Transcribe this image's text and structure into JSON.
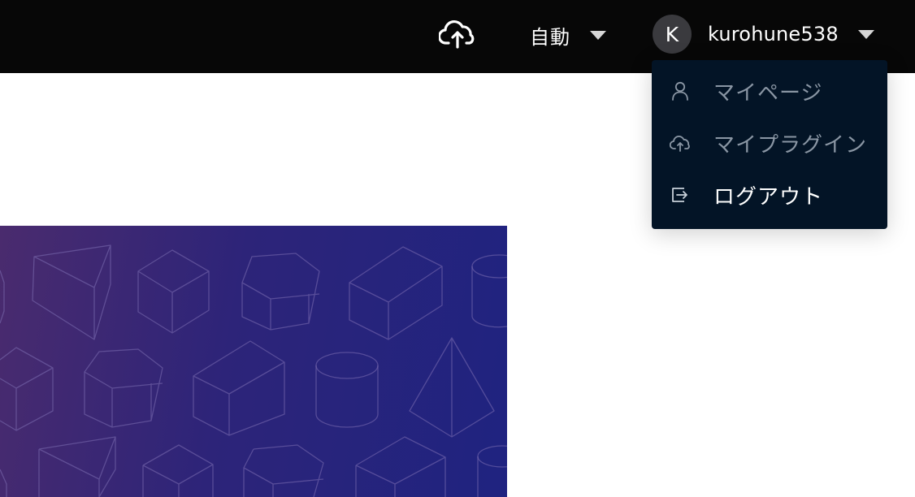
{
  "header": {
    "upload_icon": "cloud-upload-icon",
    "mode": {
      "label": "自動",
      "icon": "caret-down-icon"
    },
    "user": {
      "avatar_initial": "K",
      "username": "kurohune538",
      "icon": "caret-down-icon"
    }
  },
  "user_menu": {
    "items": [
      {
        "label": "マイページ",
        "icon": "user-icon"
      },
      {
        "label": "マイプラグイン",
        "icon": "cloud-upload-icon"
      },
      {
        "label": "ログアウト",
        "icon": "logout-icon"
      }
    ]
  },
  "colors": {
    "topbar": "#070707",
    "dropdown": "#031426",
    "banner_start": "#4a2b6e",
    "banner_end": "#1f2380"
  }
}
